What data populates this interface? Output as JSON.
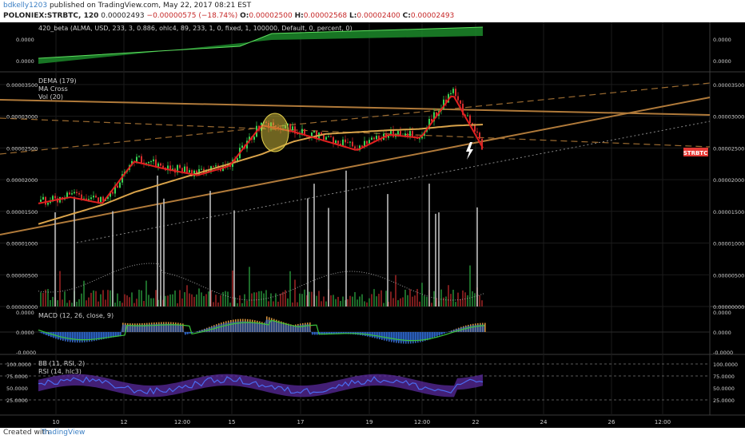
{
  "header": {
    "author": "bdkelly1203",
    "published": "published on TradingView.com, May 22, 2017 08:21 EST",
    "symbol": "POLONIEX:STRBTC, 120",
    "last": "0.00002493",
    "change": "−0.00000575 (−18.74%)",
    "ohlc": [
      {
        "k": "O:",
        "v": "0.00002500"
      },
      {
        "k": "H:",
        "v": "0.00002568"
      },
      {
        "k": "L:",
        "v": "0.00002400"
      },
      {
        "k": "C:",
        "v": "0.00002493"
      }
    ]
  },
  "panes": {
    "alma": {
      "label": "420_beta (ALMA, USD, 233, 3, 0.886, ohlc4, 89, 233, 1, 0, fixed, 1, 100000, Default, 0, percent, 0)",
      "ticks": [
        "0.0000",
        "0.0000"
      ]
    },
    "price": {
      "labels": [
        "DEMA (179)",
        "MA Cross",
        "Vol (20)"
      ],
      "ticks": [
        "0.00003500",
        "0.00003000",
        "0.00002500",
        "0.00002000",
        "0.00001500",
        "0.00001000",
        "0.00000500",
        "0.00000000"
      ],
      "badge": "STRBTC"
    },
    "macd": {
      "label": "MACD (12, 26, close, 9)",
      "ticks": [
        "0.0000",
        "0.0000",
        "-0.0000"
      ]
    },
    "rsi": {
      "labels": [
        "BB (11, RSI, 2)",
        "RSI (14, hlc3)"
      ],
      "ticks": [
        "100.0000",
        "75.0000",
        "50.0000",
        "25.0000"
      ]
    }
  },
  "x_axis": [
    "10",
    "12",
    "12:00",
    "15",
    "17",
    "19",
    "12:00",
    "22",
    "24",
    "26",
    "12:00"
  ],
  "footer": {
    "created": "Created with",
    "brand": "TradingView"
  },
  "colors": {
    "up": "#39d353",
    "down": "#d62c2c",
    "dema": "#d9a34a",
    "ma_red": "#e02020",
    "trend": "#b07a3a",
    "macd": "#2a62c8",
    "alma": "#1c8a2a",
    "rsi_band": "#5a2a9c",
    "badge": "#e53935"
  },
  "chart_data": [
    {
      "type": "line",
      "title": "POLONIEX:STRBTC, 120",
      "xlabel": "",
      "ylabel": "",
      "x": [
        "9",
        "10",
        "11",
        "12",
        "13",
        "14",
        "15",
        "16",
        "17",
        "18",
        "19",
        "20",
        "21",
        "22",
        "22"
      ],
      "ylim": [
        0,
        3.7e-05
      ],
      "series": [
        {
          "name": "STRBTC",
          "values": [
            1.65e-05,
            1.75e-05,
            1.65e-05,
            2.32e-05,
            2.2e-05,
            2.1e-05,
            2.25e-05,
            2.9e-05,
            2.8e-05,
            2.65e-05,
            2.5e-05,
            2.75e-05,
            2.7e-05,
            3.4e-05,
            2.493e-05
          ]
        },
        {
          "name": "DEMA (179)",
          "values": [
            1.3e-05,
            1.45e-05,
            1.6e-05,
            1.8e-05,
            1.95e-05,
            2.1e-05,
            2.25e-05,
            2.4e-05,
            2.6e-05,
            2.72e-05,
            2.75e-05,
            2.78e-05,
            2.8e-05,
            2.85e-05,
            2.87e-05
          ]
        }
      ]
    }
  ]
}
